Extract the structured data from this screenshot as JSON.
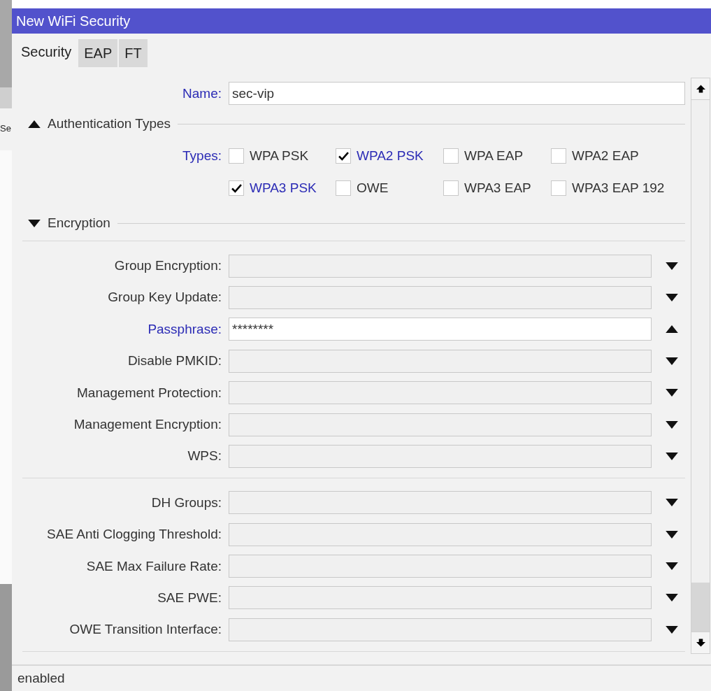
{
  "background_window": {
    "text": "Se"
  },
  "window": {
    "title": "New WiFi Security"
  },
  "tabs": [
    {
      "label": "Security",
      "selected": true
    },
    {
      "label": "EAP",
      "selected": false
    },
    {
      "label": "FT",
      "selected": false
    }
  ],
  "name": {
    "label": "Name:",
    "value": "sec-vip"
  },
  "authentication": {
    "title": "Authentication Types",
    "expanded": true,
    "label": "Types:",
    "types": [
      {
        "label": "WPA PSK",
        "checked": false
      },
      {
        "label": "WPA2 PSK",
        "checked": true
      },
      {
        "label": "WPA EAP",
        "checked": false
      },
      {
        "label": "WPA2 EAP",
        "checked": false
      },
      {
        "label": "WPA3 PSK",
        "checked": true
      },
      {
        "label": "OWE",
        "checked": false
      },
      {
        "label": "WPA3 EAP",
        "checked": false
      },
      {
        "label": "WPA3 EAP 192",
        "checked": false
      }
    ]
  },
  "encryption": {
    "title": "Encryption",
    "expanded": false,
    "groups": [
      [
        {
          "label": "Group Encryption:",
          "active": false,
          "open": false
        },
        {
          "label": "Group Key Update:",
          "active": false,
          "open": false
        },
        {
          "label": "Passphrase:",
          "value": "********",
          "active": true,
          "open": true
        },
        {
          "label": "Disable PMKID:",
          "active": false,
          "open": false
        },
        {
          "label": "Management Protection:",
          "active": false,
          "open": false
        },
        {
          "label": "Management Encryption:",
          "active": false,
          "open": false
        },
        {
          "label": "WPS:",
          "active": false,
          "open": false
        }
      ],
      [
        {
          "label": "DH Groups:",
          "active": false,
          "open": false
        },
        {
          "label": "SAE Anti Clogging Threshold:",
          "active": false,
          "open": false
        },
        {
          "label": "SAE Max Failure Rate:",
          "active": false,
          "open": false
        },
        {
          "label": "SAE PWE:",
          "active": false,
          "open": false
        },
        {
          "label": "OWE Transition Interface:",
          "active": false,
          "open": false
        }
      ]
    ]
  },
  "status_bar": {
    "text": "enabled"
  }
}
